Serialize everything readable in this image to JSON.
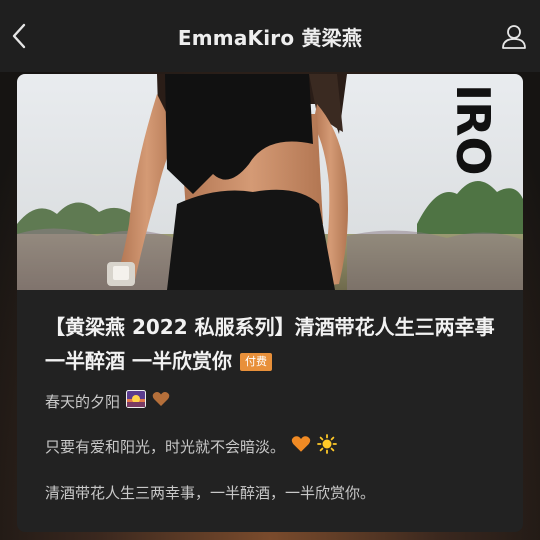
{
  "header": {
    "title": "EmmaKiro 黄梁燕",
    "back_icon": "chevron-left-icon",
    "user_icon": "user-icon"
  },
  "post": {
    "cover_text": "IRO",
    "title": "【黄梁燕 2022 私服系列】清酒带花人生三两幸事 一半醉酒 一半欣赏你",
    "badge": "付费",
    "author": "春天的夕阳",
    "author_icons": [
      "sunset-emoji-icon",
      "brown-heart-icon"
    ],
    "paragraph1": "只要有爱和阳光，时光就不会暗淡。",
    "paragraph1_icons": [
      "orange-heart-icon",
      "sun-icon"
    ],
    "paragraph2": "清酒带花人生三两幸事，一半醉酒，一半欣赏你。"
  },
  "colors": {
    "topbar": "#1f1f1f",
    "card": "#222222",
    "badge": "#e8903a",
    "title_text": "#f2f2f2"
  }
}
